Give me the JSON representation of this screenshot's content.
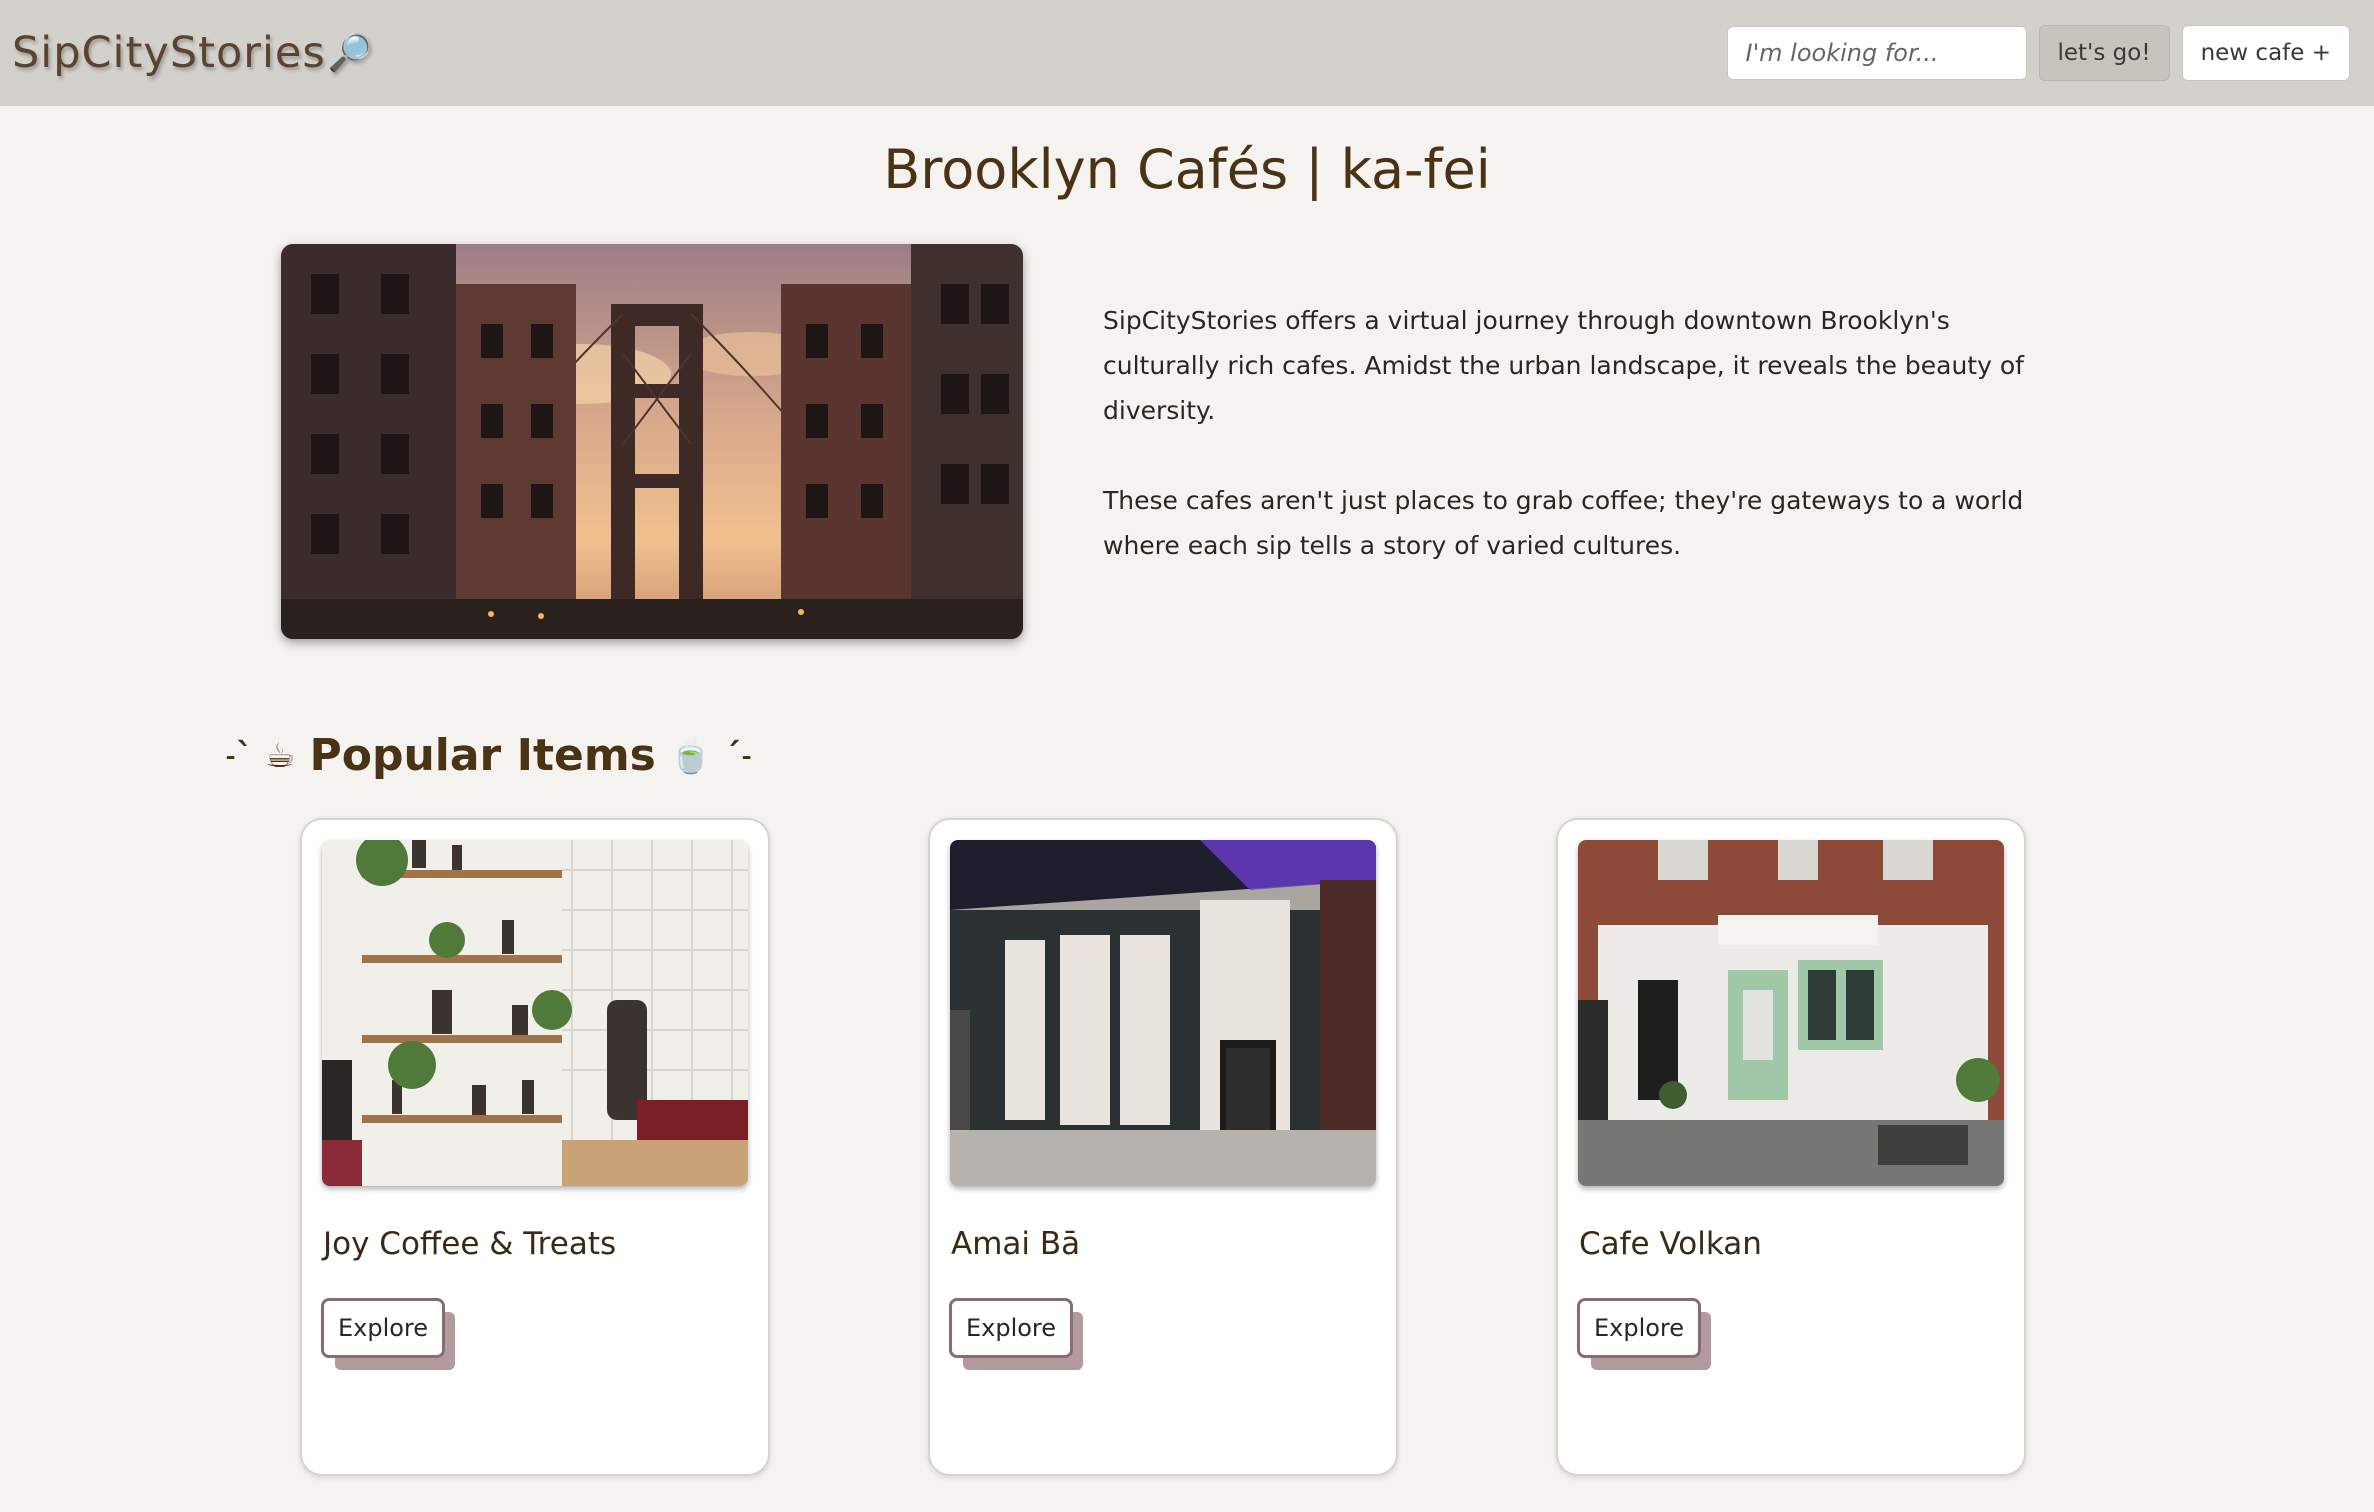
{
  "header": {
    "logo_text": "SipCityStories",
    "logo_icon": "🔎",
    "search_placeholder": "I'm looking for...",
    "go_label": "let's go!",
    "new_cafe_label": "new cafe +"
  },
  "hero": {
    "title": "Brooklyn Cafés | ka-fei",
    "paragraphs": [
      "SipCityStories offers a virtual journey through downtown Brooklyn's culturally rich cafes. Amidst the urban landscape, it reveals the beauty of diversity.",
      "These cafes aren't just places to grab coffee; they're gateways to a world where each sip tells a story of varied cultures."
    ]
  },
  "popular": {
    "title": "Popular Items",
    "left_deco": "˗ˋ ☕",
    "right_deco": "🍵 ˊ˗",
    "cards": [
      {
        "name": "Joy Coffee & Treats",
        "button": "Explore"
      },
      {
        "name": "Amai Bā",
        "button": "Explore"
      },
      {
        "name": "Cafe Volkan",
        "button": "Explore"
      }
    ]
  },
  "colors": {
    "navbar": "#d3d1cc",
    "background": "#f5f3f0",
    "title_brown": "#4a3214",
    "explore_border": "#8a6b70",
    "explore_shadow": "#b39a9e"
  }
}
